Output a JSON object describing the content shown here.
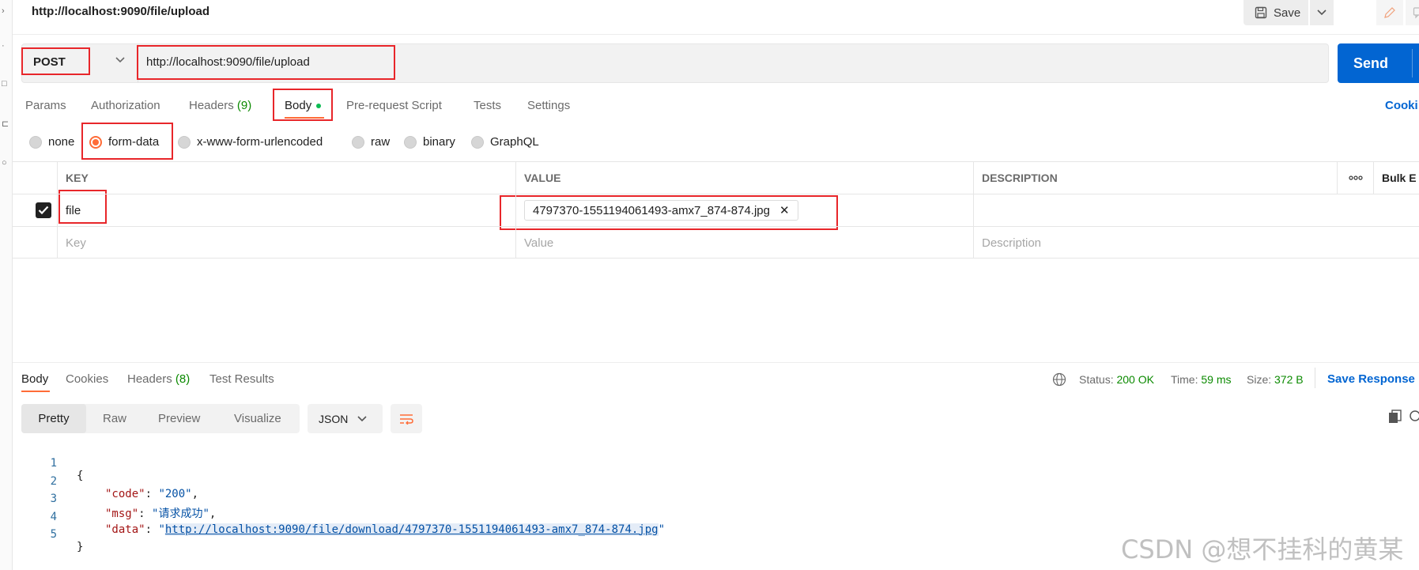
{
  "request": {
    "title": "http://localhost:9090/file/upload",
    "save_label": "Save",
    "method": "POST",
    "url": "http://localhost:9090/file/upload",
    "send_label": "Send",
    "cookies_label": "Cooki"
  },
  "req_tabs": [
    {
      "label": "Params",
      "count": ""
    },
    {
      "label": "Authorization",
      "count": ""
    },
    {
      "label": "Headers",
      "count": "(9)"
    },
    {
      "label": "Body",
      "count": ""
    },
    {
      "label": "Pre-request Script",
      "count": ""
    },
    {
      "label": "Tests",
      "count": ""
    },
    {
      "label": "Settings",
      "count": ""
    }
  ],
  "body_types": [
    "none",
    "form-data",
    "x-www-form-urlencoded",
    "raw",
    "binary",
    "GraphQL"
  ],
  "form_table": {
    "headers": {
      "key": "KEY",
      "value": "VALUE",
      "description": "DESCRIPTION",
      "bulk": "Bulk E"
    },
    "rows": [
      {
        "key": "file",
        "value": "4797370-1551194061493-amx7_874-874.jpg",
        "description": ""
      }
    ],
    "placeholders": {
      "key": "Key",
      "value": "Value",
      "description": "Description"
    }
  },
  "response": {
    "tabs": [
      {
        "label": "Body",
        "count": ""
      },
      {
        "label": "Cookies",
        "count": ""
      },
      {
        "label": "Headers",
        "count": "(8)"
      },
      {
        "label": "Test Results",
        "count": ""
      }
    ],
    "status_label": "Status:",
    "status_value": "200 OK",
    "time_label": "Time:",
    "time_value": "59 ms",
    "size_label": "Size:",
    "size_value": "372 B",
    "save_response_label": "Save Response",
    "views": [
      "Pretty",
      "Raw",
      "Preview",
      "Visualize"
    ],
    "format": "JSON",
    "code_lines": [
      {
        "n": "1",
        "text": "{"
      },
      {
        "n": "2",
        "key": "\"code\"",
        "value": "\"200\"",
        "trail": ","
      },
      {
        "n": "3",
        "key": "\"msg\"",
        "value": "\"请求成功\"",
        "trail": ","
      },
      {
        "n": "4",
        "key": "\"data\"",
        "value": "http://localhost:9090/file/download/4797370-1551194061493-amx7_874-874.jpg"
      },
      {
        "n": "5",
        "text": "}"
      }
    ]
  },
  "watermark": "CSDN @想不挂科的黄某",
  "colors": {
    "accent": "#ff6c37",
    "send": "#0265d2",
    "status_ok": "#0b8a00",
    "highlight_box": "#e8262a"
  }
}
